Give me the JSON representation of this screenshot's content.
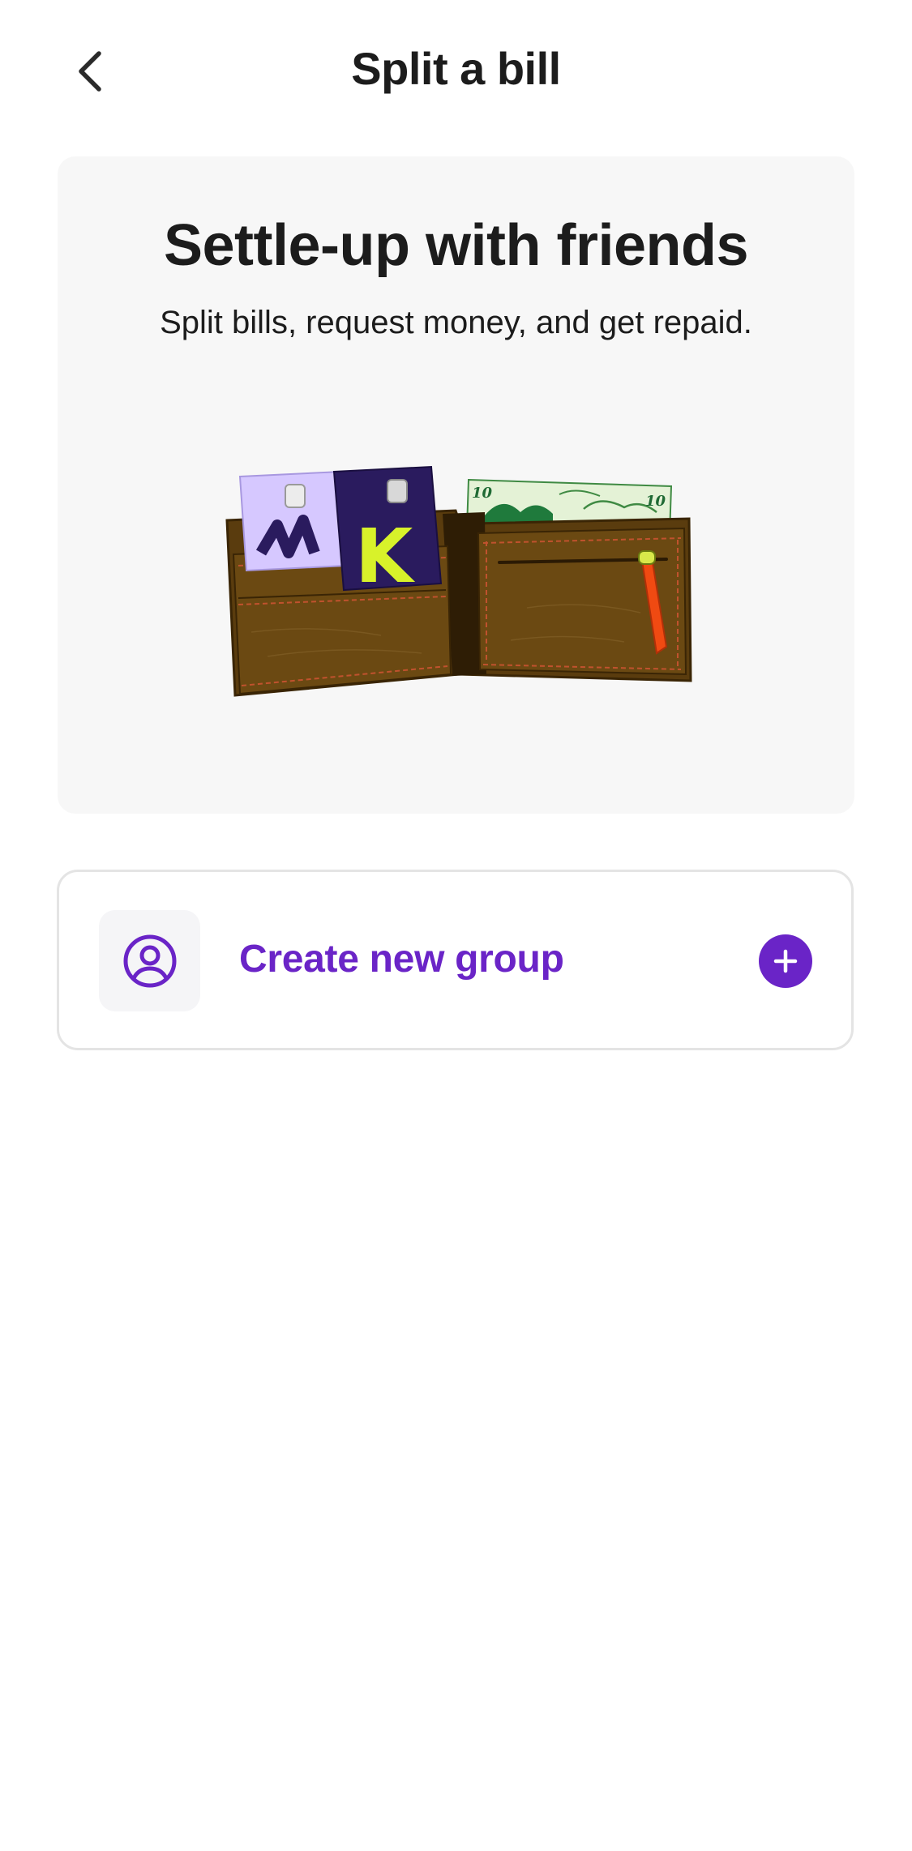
{
  "header": {
    "title": "Split a bill",
    "back_icon": "chevron-left-icon"
  },
  "hero": {
    "title": "Settle-up with friends",
    "subtitle": "Split bills, request money, and get repaid.",
    "illustration": "wallet-with-cards-and-cash",
    "card_letter": "K",
    "banknote_denomination": "10"
  },
  "actions": {
    "create_group_label": "Create new group",
    "create_group_icon": "user-circle-icon",
    "add_icon": "plus-icon"
  },
  "colors": {
    "accent": "#6a24c7",
    "card_background": "#f7f7f7",
    "text": "#1c1c1c",
    "border": "#e4e4e4"
  }
}
